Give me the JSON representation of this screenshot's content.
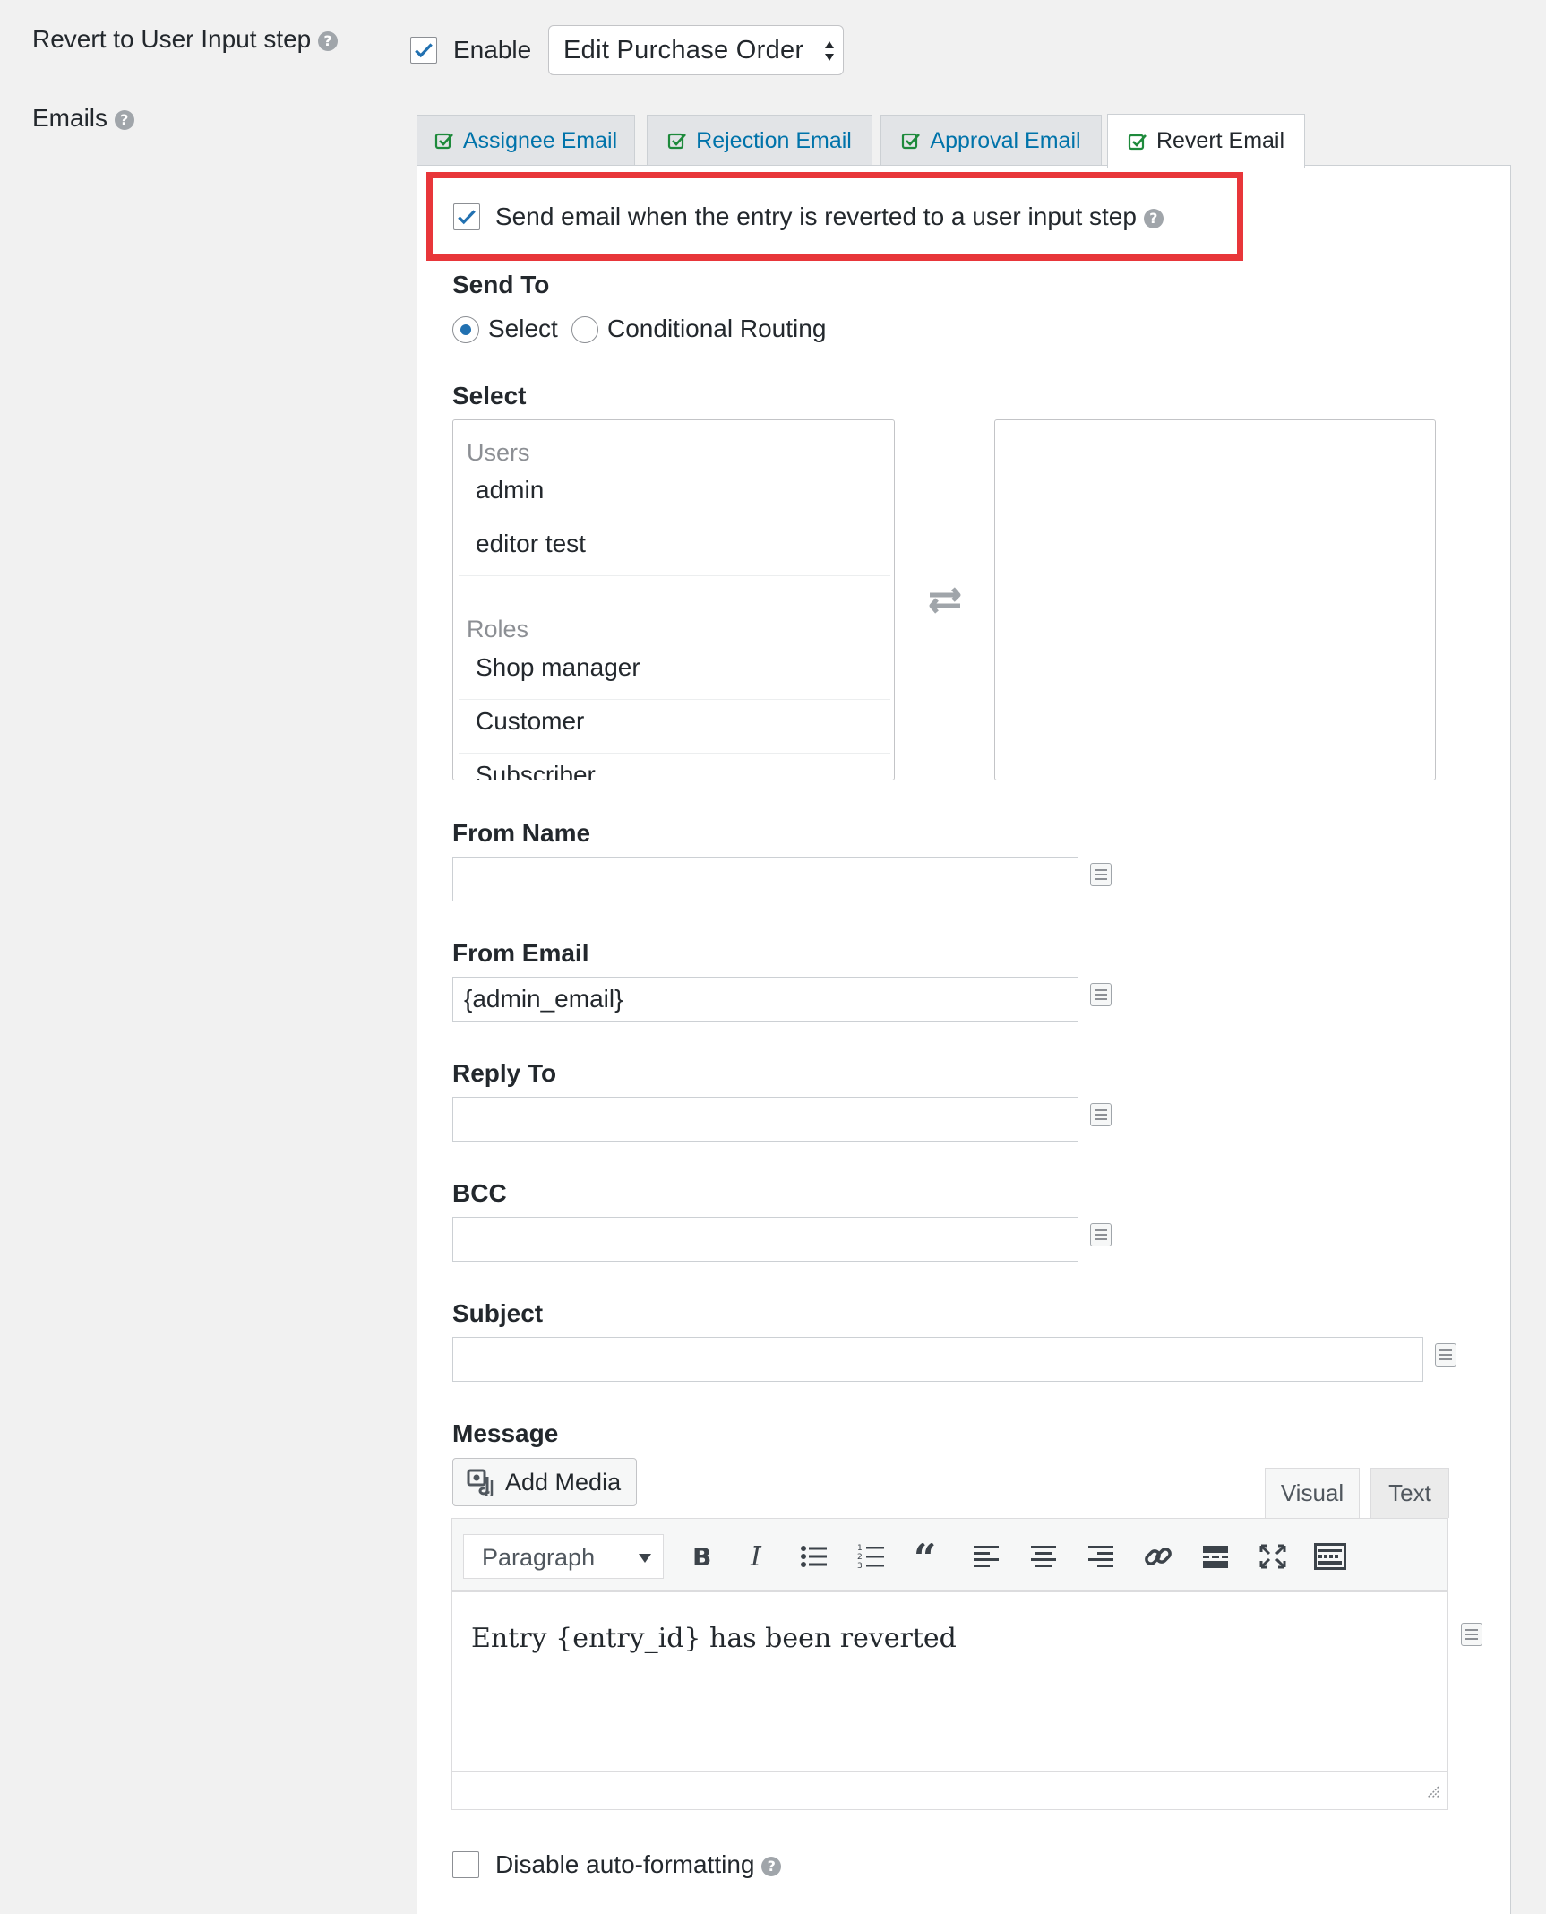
{
  "revert_row": {
    "label": "Revert to User Input step",
    "enable_label": "Enable",
    "enable_checked": true,
    "step_select": "Edit Purchase Order"
  },
  "emails_row": {
    "label": "Emails"
  },
  "tabs": [
    {
      "label": "Assignee Email",
      "active": false
    },
    {
      "label": "Rejection Email",
      "active": false
    },
    {
      "label": "Approval Email",
      "active": false
    },
    {
      "label": "Revert Email",
      "active": true
    }
  ],
  "send_email_checkbox": {
    "label": "Send email when the entry is reverted to a user input step",
    "checked": true,
    "highlight_color": "#e8363a"
  },
  "send_to": {
    "label": "Send To",
    "options": [
      "Select",
      "Conditional Routing"
    ],
    "selected": "Select"
  },
  "select_section": {
    "label": "Select",
    "groups": [
      {
        "label": "Users",
        "items": [
          "admin",
          "editor test"
        ]
      },
      {
        "label": "Roles",
        "items": [
          "Shop manager",
          "Customer",
          "Subscriber"
        ]
      }
    ]
  },
  "fields": {
    "from_name": {
      "label": "From Name",
      "value": ""
    },
    "from_email": {
      "label": "From Email",
      "value": "{admin_email}"
    },
    "reply_to": {
      "label": "Reply To",
      "value": ""
    },
    "bcc": {
      "label": "BCC",
      "value": ""
    },
    "subject": {
      "label": "Subject",
      "value": ""
    }
  },
  "message": {
    "label": "Message",
    "add_media": "Add Media",
    "editor_tabs": [
      "Visual",
      "Text"
    ],
    "active_editor_tab": "Visual",
    "format_select": "Paragraph",
    "content": "Entry {entry_id} has been reverted"
  },
  "disable_autoformat": {
    "label": "Disable auto-formatting",
    "checked": false
  },
  "colors": {
    "accent": "#2271b1",
    "link": "#0073aa",
    "tab_check": "#1e8a3c"
  }
}
